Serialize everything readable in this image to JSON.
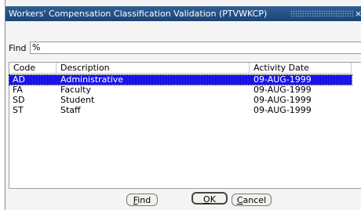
{
  "window": {
    "title": "Workers' Compensation Classification Validation (PTVWKCP)",
    "close_glyph": "×"
  },
  "find": {
    "label": "Find",
    "value": "%"
  },
  "columns": {
    "code": "Code",
    "description": "Description",
    "activity_date": "Activity Date"
  },
  "rows": [
    {
      "code": "AD",
      "description": "Administrative",
      "date": "09-AUG-1999"
    },
    {
      "code": "FA",
      "description": "Faculty",
      "date": "09-AUG-1999"
    },
    {
      "code": "SD",
      "description": "Student",
      "date": "09-AUG-1999"
    },
    {
      "code": "ST",
      "description": "Staff",
      "date": "09-AUG-1999"
    }
  ],
  "buttons": {
    "find": {
      "pre": "",
      "key": "F",
      "post": "ind"
    },
    "ok": {
      "pre": "",
      "key": "O",
      "post": "K"
    },
    "cancel": {
      "pre": "",
      "key": "C",
      "post": "ancel"
    }
  },
  "colors": {
    "selection": "#1a13ec",
    "titlebar": "#1c4474"
  }
}
